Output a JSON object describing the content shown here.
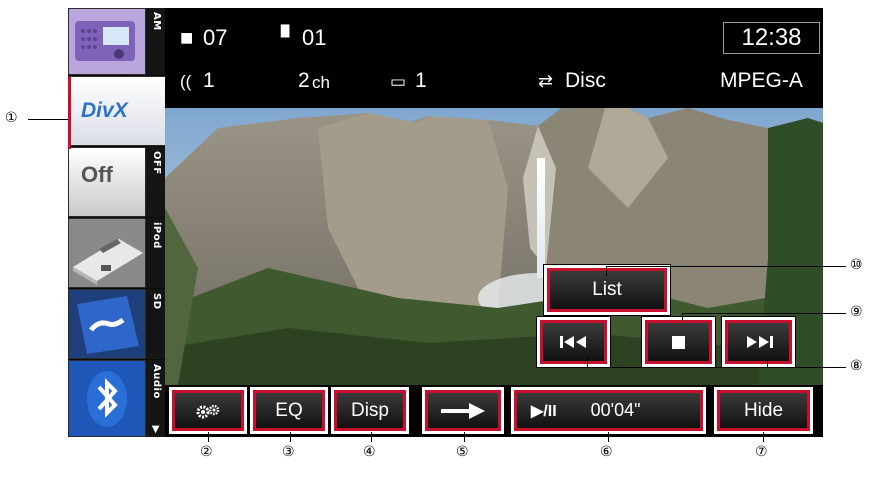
{
  "status": {
    "folder_number": "07",
    "file_number": "01",
    "audio_channel": "1",
    "channels_value": "2",
    "channels_unit": "ch",
    "subtitle_number": "1",
    "repeat_mode": "Disc",
    "format": "MPEG-A",
    "clock": "12:38"
  },
  "sidebar": {
    "sources": [
      {
        "label": "AM"
      },
      {
        "label": "DivX"
      },
      {
        "label": "OFF",
        "tile_text": "Off"
      },
      {
        "label": "iPod"
      },
      {
        "label": "SD"
      },
      {
        "label": "Audio"
      }
    ]
  },
  "controls": {
    "list_label": "List",
    "eq_label": "EQ",
    "disp_label": "Disp",
    "play_pause_label": "▶/II",
    "elapsed_time": "00'04\"",
    "hide_label": "Hide"
  },
  "callouts": [
    "①",
    "②",
    "③",
    "④",
    "⑤",
    "⑥",
    "⑦",
    "⑧",
    "⑨",
    "⑩"
  ],
  "colors": {
    "highlight": "#c8102e",
    "accent_blue": "#2a73c6"
  }
}
